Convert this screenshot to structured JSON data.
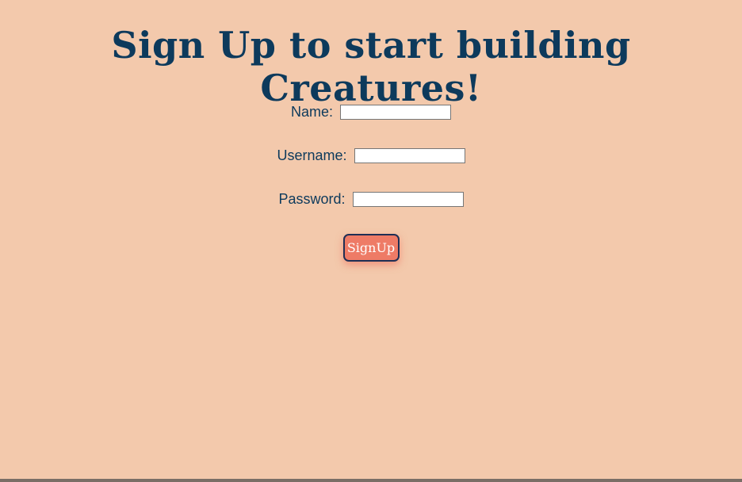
{
  "page": {
    "title": "Sign Up to start building Creatures!"
  },
  "form": {
    "name_label": "Name:",
    "name_value": "",
    "username_label": "Username:",
    "username_value": "",
    "password_label": "Password:",
    "password_value": "",
    "submit_label": "SignUp"
  },
  "colors": {
    "background": "#f3c9ac",
    "text": "#0d3a5c",
    "button": "#ee7b66",
    "button_border": "#1f2f55"
  }
}
